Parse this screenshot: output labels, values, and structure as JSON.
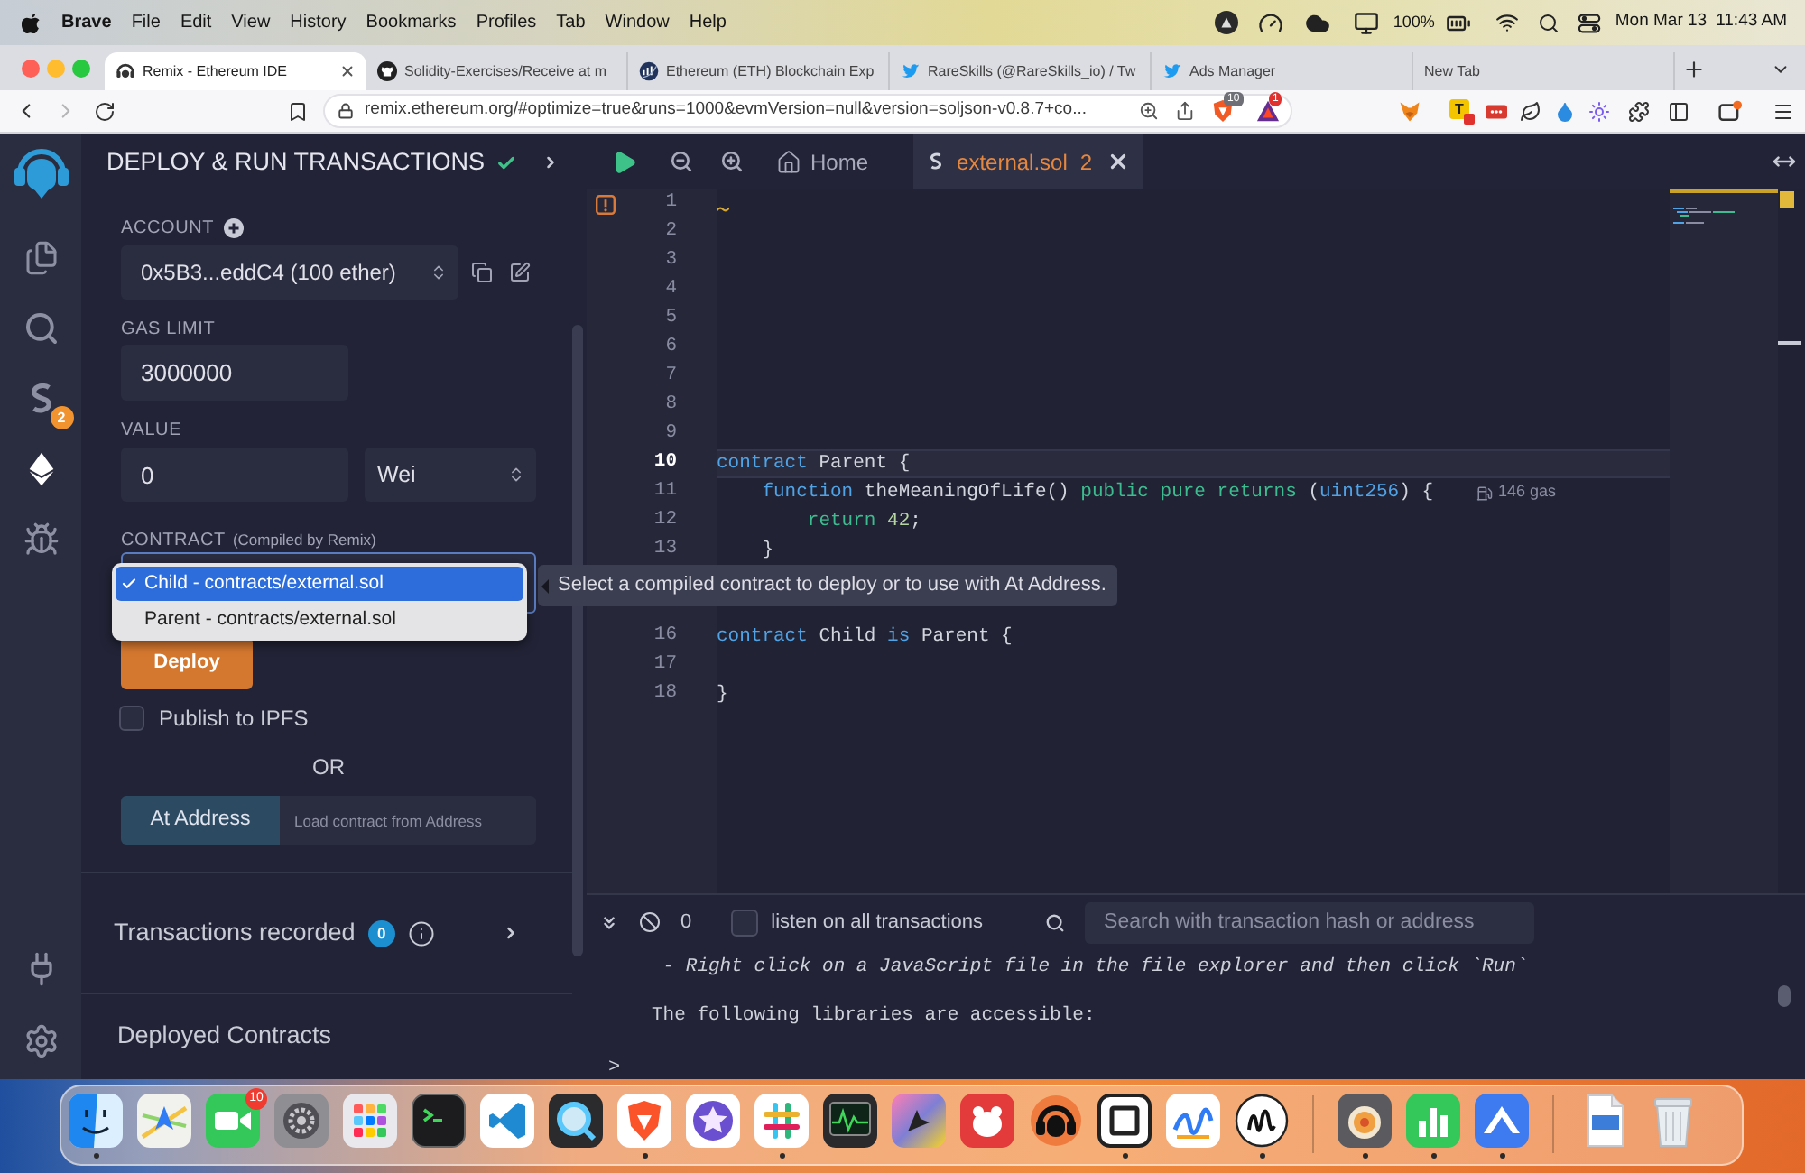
{
  "menu_bar": {
    "app_name": "Brave",
    "menus": [
      "File",
      "Edit",
      "View",
      "History",
      "Bookmarks",
      "Profiles",
      "Tab",
      "Window",
      "Help"
    ],
    "battery": "100%",
    "date": "Mon Mar 13",
    "time": "11:43 AM"
  },
  "browser": {
    "tabs": [
      {
        "title": "Remix - Ethereum IDE",
        "kind": "remix",
        "selected": true
      },
      {
        "title": "Solidity-Exercises/Receive at m",
        "kind": "github",
        "selected": false
      },
      {
        "title": "Ethereum (ETH) Blockchain Exp",
        "kind": "globe",
        "selected": false
      },
      {
        "title": "RareSkills (@RareSkills_io) / Tw",
        "kind": "bird",
        "selected": false
      },
      {
        "title": "Ads Manager",
        "kind": "bird",
        "selected": false
      },
      {
        "title": "New Tab",
        "kind": "blank",
        "selected": false
      }
    ],
    "address": "remix.ethereum.org/#optimize=true&runs=1000&evmVersion=null&version=soljson-v0.8.7+co...",
    "shield_badge": "10",
    "rewards_badge": "1",
    "extension_tile": "T"
  },
  "sidebar": {
    "items": [
      {
        "kind": "files",
        "selected": false
      },
      {
        "kind": "search",
        "selected": false
      },
      {
        "kind": "compiler",
        "selected": false,
        "badge": "2"
      },
      {
        "kind": "deploy",
        "selected": true
      },
      {
        "kind": "debugger",
        "selected": false
      }
    ]
  },
  "panel": {
    "title": "DEPLOY & RUN TRANSACTIONS",
    "account": {
      "label": "ACCOUNT",
      "value": "0x5B3...eddC4 (100 ether)"
    },
    "gas_limit": {
      "label": "GAS LIMIT",
      "value": "3000000"
    },
    "value": {
      "label": "VALUE",
      "amount": "0",
      "unit": "Wei"
    },
    "contract": {
      "label": "CONTRACT",
      "note": "(Compiled by Remix)",
      "open": true,
      "options": [
        {
          "label": "Child - contracts/external.sol",
          "selected": true
        },
        {
          "label": "Parent - contracts/external.sol",
          "selected": false
        }
      ],
      "tooltip": "Select a compiled contract to deploy or to use with At Address."
    },
    "deploy_button": "Deploy",
    "publish": {
      "label": "Publish to IPFS",
      "checked": false
    },
    "or_text": "OR",
    "at_address": {
      "button": "At Address",
      "placeholder": "Load contract from Address"
    },
    "transactions": {
      "label": "Transactions recorded",
      "count": "0",
      "expanded": false
    },
    "deployed": {
      "label": "Deployed Contracts"
    }
  },
  "editor": {
    "tabs": [
      {
        "title": "Home",
        "kind": "home",
        "selected": false
      },
      {
        "title": "external.sol",
        "kind": "file",
        "problems": "2",
        "selected": true
      }
    ],
    "lines": [
      {
        "number": "1",
        "warning": true,
        "current": false
      },
      {
        "number": "2",
        "warning": false,
        "current": false
      },
      {
        "number": "3",
        "warning": false,
        "current": false
      },
      {
        "number": "4",
        "warning": false,
        "current": false
      },
      {
        "number": "5",
        "warning": false,
        "current": false
      },
      {
        "number": "6",
        "warning": false,
        "current": false
      },
      {
        "number": "7",
        "warning": false,
        "current": false
      },
      {
        "number": "8",
        "warning": false,
        "current": false
      },
      {
        "number": "9",
        "warning": false,
        "current": false
      },
      {
        "number": "10",
        "warning": false,
        "current": true,
        "tokens": [
          {
            "text": "contract",
            "kind": "keyword"
          },
          {
            "text": " Parent {",
            "kind": "plain"
          }
        ]
      },
      {
        "number": "11",
        "warning": false,
        "current": false,
        "tokens": [
          {
            "text": "    function",
            "kind": "keyword"
          },
          {
            "text": " theMeaningOfLife() ",
            "kind": "plain"
          },
          {
            "text": "public pure returns",
            "kind": "modifier"
          },
          {
            "text": " (",
            "kind": "plain"
          },
          {
            "text": "uint256",
            "kind": "keyword"
          },
          {
            "text": ") {",
            "kind": "plain"
          }
        ],
        "hint": "146 gas"
      },
      {
        "number": "12",
        "warning": false,
        "current": false,
        "tokens": [
          {
            "text": "        return ",
            "kind": "modifier"
          },
          {
            "text": "42",
            "kind": "number"
          },
          {
            "text": ";",
            "kind": "plain"
          }
        ]
      },
      {
        "number": "13",
        "warning": false,
        "current": false,
        "tokens": [
          {
            "text": "    }",
            "kind": "plain"
          }
        ]
      },
      {
        "number": "16",
        "warning": false,
        "current": false,
        "tokens": [
          {
            "text": "contract",
            "kind": "keyword"
          },
          {
            "text": " Child ",
            "kind": "plain"
          },
          {
            "text": "is",
            "kind": "keyword"
          },
          {
            "text": " Parent {",
            "kind": "plain"
          }
        ]
      },
      {
        "number": "17",
        "warning": false,
        "current": false
      },
      {
        "number": "18",
        "warning": false,
        "current": false,
        "tokens": [
          {
            "text": "}",
            "kind": "plain"
          }
        ]
      }
    ]
  },
  "terminal": {
    "pending_count": "0",
    "listen": {
      "label": "listen on all transactions",
      "checked": false
    },
    "search_placeholder": "Search with transaction hash or address",
    "lines": [
      {
        "text": " - Right click on a JavaScript file in the file explorer and then click `Run`",
        "italic": true
      },
      {
        "text": "The following libraries are accessible:",
        "italic": false
      }
    ],
    "prompt": ">"
  },
  "dock": {
    "sections": [
      {
        "apps": [
          {
            "kind": "face",
            "running": true
          },
          {
            "kind": "map",
            "running": false
          },
          {
            "kind": "camera",
            "running": false,
            "badge": "10"
          },
          {
            "kind": "gear",
            "running": false
          },
          {
            "kind": "grid",
            "running": false
          },
          {
            "kind": "terminal",
            "running": false
          },
          {
            "kind": "ribbon",
            "running": false
          },
          {
            "kind": "magnifier",
            "running": false
          },
          {
            "kind": "shield",
            "running": true
          },
          {
            "kind": "star",
            "running": false
          },
          {
            "kind": "hash",
            "running": true
          },
          {
            "kind": "chart",
            "running": false
          },
          {
            "kind": "arrow",
            "running": false
          },
          {
            "kind": "bear",
            "running": false
          },
          {
            "kind": "headset",
            "running": false
          },
          {
            "kind": "cube",
            "running": true
          },
          {
            "kind": "scribble",
            "running": false
          },
          {
            "kind": "wave",
            "running": true
          }
        ]
      },
      {
        "apps": [
          {
            "kind": "dish",
            "running": true
          },
          {
            "kind": "bars",
            "running": true
          },
          {
            "kind": "mountain",
            "running": true
          }
        ]
      },
      {
        "apps": [
          {
            "kind": "document",
            "running": false
          },
          {
            "kind": "trash",
            "running": false
          }
        ]
      }
    ]
  }
}
